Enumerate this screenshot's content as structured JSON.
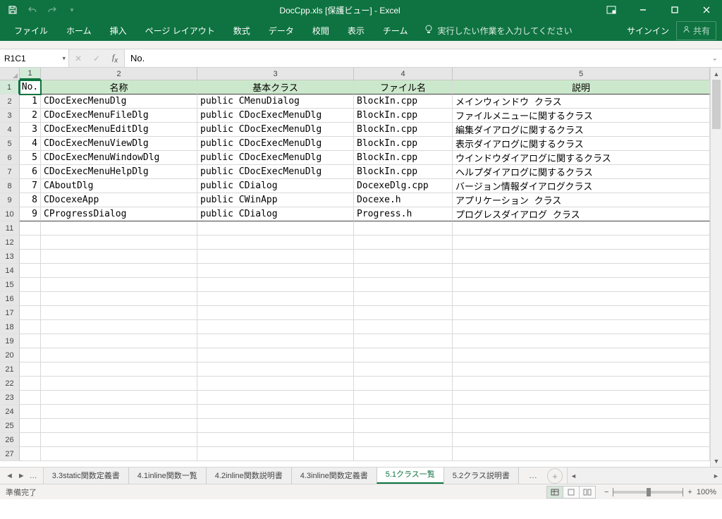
{
  "titlebar": {
    "title": "DocCpp.xls  [保護ビュー] - Excel"
  },
  "ribbon": {
    "tabs": [
      "ファイル",
      "ホーム",
      "挿入",
      "ページ レイアウト",
      "数式",
      "データ",
      "校閲",
      "表示",
      "チーム"
    ],
    "tellme": "実行したい作業を入力してください",
    "signin": "サインイン",
    "share": "共有"
  },
  "formulabar": {
    "namebox": "R1C1",
    "formula": "No."
  },
  "grid": {
    "col_headers": [
      "1",
      "2",
      "3",
      "4",
      "5"
    ],
    "row_headers": [
      "1",
      "2",
      "3",
      "4",
      "5",
      "6",
      "7",
      "8",
      "9",
      "10",
      "11",
      "12",
      "13",
      "14",
      "15",
      "16",
      "17",
      "18",
      "19",
      "20",
      "21",
      "22",
      "23",
      "24",
      "25",
      "26",
      "27"
    ],
    "header_row": [
      "No.",
      "名称",
      "基本クラス",
      "ファイル名",
      "説明"
    ],
    "data": [
      [
        "1",
        "CDocExecMenuDlg",
        "public CMenuDialog",
        "BlockIn.cpp",
        "メインウィンドウ クラス"
      ],
      [
        "2",
        "CDocExecMenuFileDlg",
        "public CDocExecMenuDlg",
        "BlockIn.cpp",
        "ファイルメニューに関するクラス"
      ],
      [
        "3",
        "CDocExecMenuEditDlg",
        "public CDocExecMenuDlg",
        "BlockIn.cpp",
        "編集ダイアログに関するクラス"
      ],
      [
        "4",
        "CDocExecMenuViewDlg",
        "public CDocExecMenuDlg",
        "BlockIn.cpp",
        "表示ダイアログに関するクラス"
      ],
      [
        "5",
        "CDocExecMenuWindowDlg",
        "public CDocExecMenuDlg",
        "BlockIn.cpp",
        "ウインドウダイアログに関するクラス"
      ],
      [
        "6",
        "CDocExecMenuHelpDlg",
        "public CDocExecMenuDlg",
        "BlockIn.cpp",
        "ヘルプダイアログに関するクラス"
      ],
      [
        "7",
        "CAboutDlg",
        "public CDialog",
        "DocexeDlg.cpp",
        "バージョン情報ダイアログクラス"
      ],
      [
        "8",
        "CDocexeApp",
        "public CWinApp",
        "Docexe.h",
        "アプリケーション クラス"
      ],
      [
        "9",
        "CProgressDialog",
        "public CDialog",
        "Progress.h",
        "プログレスダイアログ クラス"
      ]
    ]
  },
  "sheets": {
    "tabs": [
      "3.3static関数定義書",
      "4.1inline関数一覧",
      "4.2inline関数説明書",
      "4.3inline関数定義書",
      "5.1クラス一覧",
      "5.2クラス説明書"
    ],
    "active": "5.1クラス一覧"
  },
  "statusbar": {
    "status": "準備完了",
    "zoom": "100%"
  }
}
